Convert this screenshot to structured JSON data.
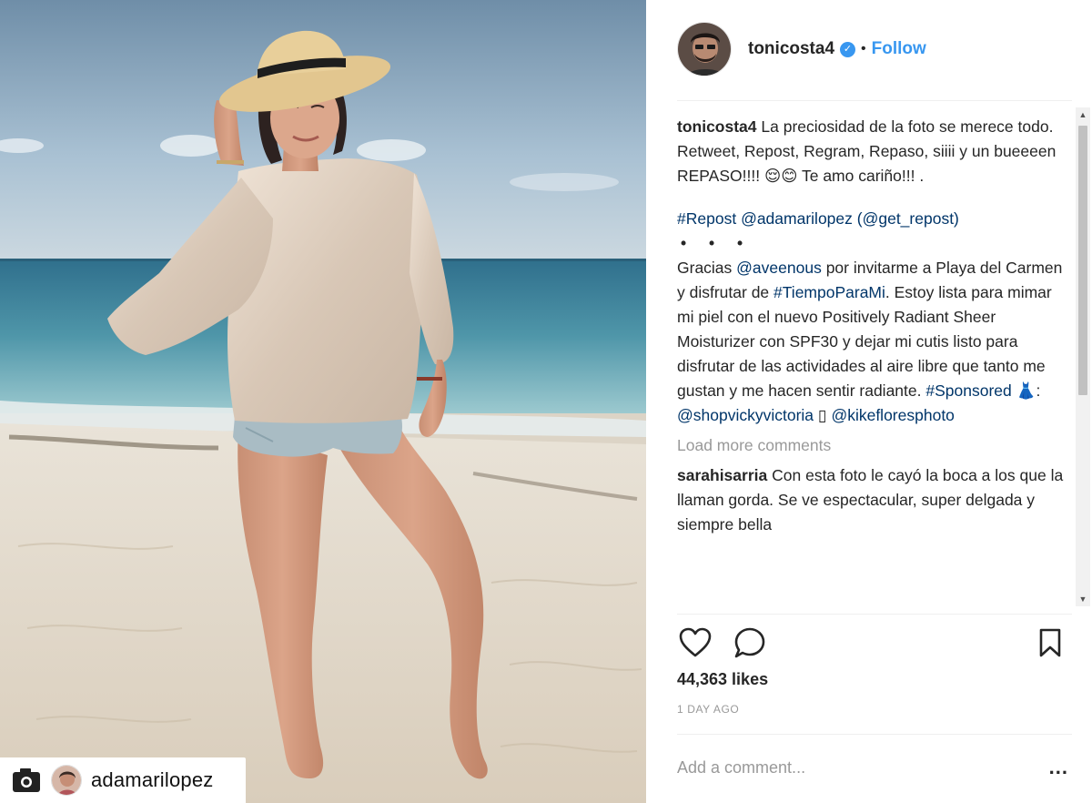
{
  "post": {
    "photo_description_alt": "",
    "repost_username": "adamarilopez"
  },
  "header": {
    "username": "tonicosta4",
    "verified_glyph": "✓",
    "separator": "•",
    "follow_label": "Follow"
  },
  "comments": {
    "caption_user": "tonicosta4",
    "caption_text": "La preciosidad de la foto se merece todo. Retweet, Repost, Regram, Repaso, siiii y un bueeeen REPASO!!!! 😌😊 Te amo cariño!!! .",
    "repost_tag": "#Repost",
    "repost_user": "@adamarilopez",
    "repost_via": "(@get_repost)",
    "dots": "• • •",
    "body_1": "Gracias ",
    "mention_aveenous": "@aveenous",
    "body_2": " por invitarme a Playa del Carmen y disfrutar de ",
    "tag_tiempo": "#TiempoParaMi",
    "body_3": ". Estoy lista para mimar mi piel con el nuevo Positively Radiant Sheer Moisturizer con SPF30 y dejar mi cutis listo para disfrutar de las actividades al aire libre que tanto me gustan y me hacen sentir radiante.",
    "tag_sponsored": "#Sponsored",
    "dress_glyph": "👗",
    "colon": ": ",
    "mention_shop": "@shopvickyvictoria",
    "camera_glyph": "▯",
    "mention_kike": "@kikefloresphoto",
    "load_more": "Load more comments",
    "c2_user": "sarahisarria",
    "c2_text": "Con esta foto le cayó la boca a los que la llaman gorda. Se ve espectacular, super delgada y siempre bella"
  },
  "scrollbar": {
    "up_glyph": "▲",
    "down_glyph": "▼"
  },
  "actions": {
    "like_icon": "heart-icon",
    "comment_icon": "comment-bubble-icon",
    "save_icon": "bookmark-icon"
  },
  "likes": "44,363 likes",
  "time": "1 DAY AGO",
  "add_comment": {
    "placeholder": "Add a comment...",
    "more_label": "..."
  }
}
